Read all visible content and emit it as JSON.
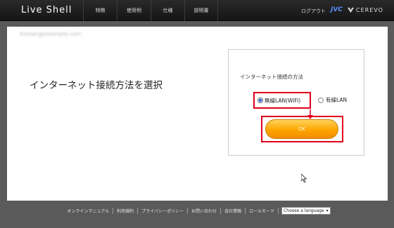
{
  "header": {
    "logo": "Live Shell",
    "nav": [
      "特徴",
      "使用例",
      "仕様",
      "説明書"
    ],
    "logout": "ログアウト",
    "jvc": "JVC",
    "cerevo": "CEREVO"
  },
  "main": {
    "email": "foobar@example.com",
    "heading": "インターネット接続方法を選択",
    "method_label": "インターネット接続の方法",
    "options": [
      {
        "label": "無線LAN(WiFi)",
        "selected": true
      },
      {
        "label": "有線LAN",
        "selected": false
      }
    ],
    "ok_label": "OK"
  },
  "footer": {
    "links": [
      "オンラインマニュアル",
      "利用規約",
      "プライバシーポリシー",
      "お問い合わせ",
      "会社情報",
      "ロールモード"
    ],
    "language_select": "Choose a language"
  },
  "colors": {
    "highlight": "#e0001b",
    "button": "#ffa500",
    "header": "#1e1e1e"
  }
}
